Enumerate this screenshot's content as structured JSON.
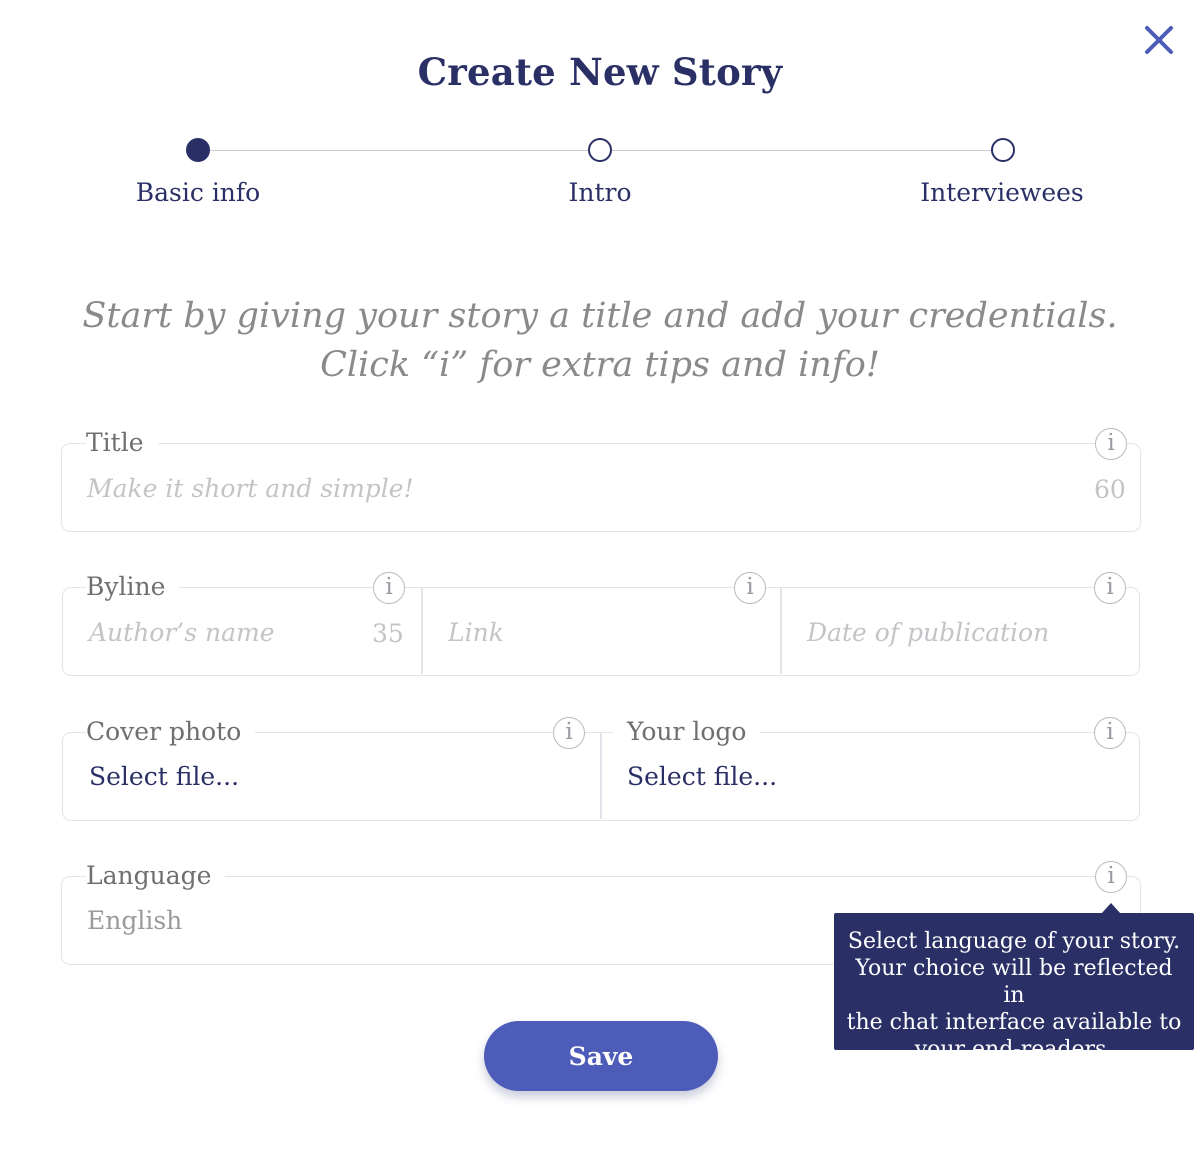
{
  "modal": {
    "title": "Create New Story",
    "close_icon": "close-icon"
  },
  "stepper": {
    "steps": [
      {
        "label": "Basic info",
        "state": "active"
      },
      {
        "label": "Intro",
        "state": "inactive"
      },
      {
        "label": "Interviewees",
        "state": "inactive"
      }
    ]
  },
  "intro_text": "Start by giving your story a title and add your credentials. Click “i” for extra tips and info!",
  "form": {
    "title": {
      "label": "Title",
      "placeholder": "Make it short and simple!",
      "counter": "60"
    },
    "byline": {
      "label": "Byline",
      "author_placeholder": "Author’s name",
      "author_counter": "35",
      "link_placeholder": "Link",
      "date_placeholder": "Date of publication"
    },
    "cover_photo": {
      "label": "Cover photo",
      "value": "Select file..."
    },
    "logo": {
      "label": "Your logo",
      "value": "Select file..."
    },
    "language": {
      "label": "Language",
      "value": "English"
    },
    "info_glyph": "i"
  },
  "tooltip": {
    "text_lines": [
      "Select language of your story.",
      "Your choice will be reflected in",
      "the chat interface available to",
      "your end-readers."
    ]
  },
  "actions": {
    "save_label": "Save"
  },
  "colors": {
    "primary_dark": "#2a3066",
    "button_blue": "#4d5cb8",
    "muted_text": "#8a8a8a",
    "placeholder": "#c4c4c8",
    "border": "#e3e4ea"
  }
}
